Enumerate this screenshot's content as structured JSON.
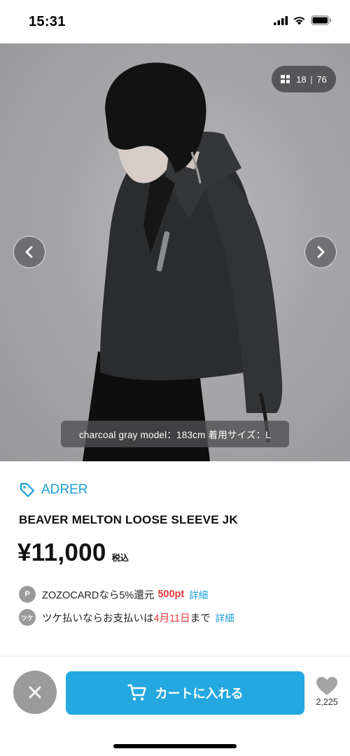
{
  "status_bar": {
    "time": "15:31"
  },
  "gallery": {
    "counter_current": "18",
    "counter_separator": "|",
    "counter_total": "76",
    "caption": "charcoal gray model：183cm 着用サイズ：L"
  },
  "product": {
    "brand": "ADRER",
    "title": "BEAVER MELTON LOOSE SLEEVE JK",
    "price": "¥11,000",
    "tax_label": "税込"
  },
  "info": {
    "zozocard": {
      "badge": "P",
      "text": "ZOZOCARDなら5%還元",
      "points": "500pt",
      "link": "詳細"
    },
    "tsuke": {
      "badge": "ツケ",
      "text_before": "ツケ払いならお支払いは",
      "date": "4月11日",
      "text_after": "まで",
      "link": "詳細"
    }
  },
  "actions": {
    "cart_label": "カートに入れる",
    "favorite_count": "2,225"
  },
  "colors": {
    "accent": "#24a8df",
    "brand_link": "#1d9fd6",
    "highlight_red": "#e6383f",
    "close_button": "#9b9b9b"
  },
  "icons": [
    "signal-icon",
    "wifi-icon",
    "battery-icon",
    "grid-icon",
    "chevron-left-icon",
    "chevron-right-icon",
    "tag-icon",
    "close-icon",
    "cart-icon",
    "heart-icon"
  ]
}
